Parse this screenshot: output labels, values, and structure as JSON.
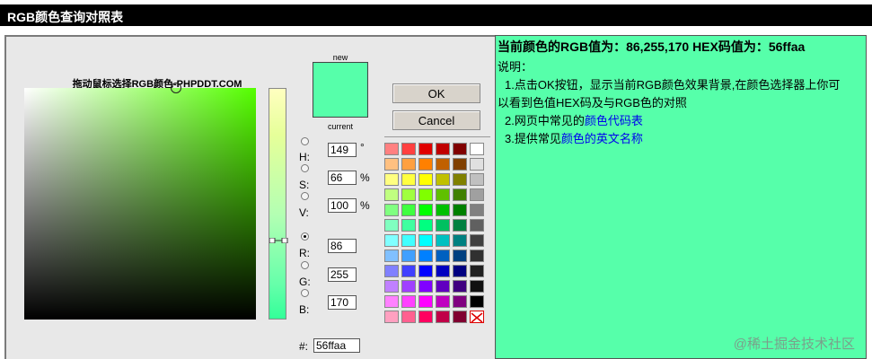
{
  "title": "RGB颜色查询对照表",
  "picker": {
    "drag_label": "拖动鼠标选择RGB颜色-PHPDDT.COM",
    "new_label": "new",
    "current_label": "current",
    "ok_label": "OK",
    "cancel_label": "Cancel",
    "selected_color": "#56ffaa",
    "fields": {
      "h": {
        "label": "H:",
        "value": "149",
        "unit": "°"
      },
      "s": {
        "label": "S:",
        "value": "66",
        "unit": "%"
      },
      "v": {
        "label": "V:",
        "value": "100",
        "unit": "%"
      },
      "r": {
        "label": "R:",
        "value": "86"
      },
      "g": {
        "label": "G:",
        "value": "255"
      },
      "b": {
        "label": "B:",
        "value": "170"
      }
    },
    "hex_label": "#:",
    "hex_value": "56ffaa",
    "palette": [
      [
        "#ff8080",
        "#ff4040",
        "#e00000",
        "#c00000",
        "#800000",
        "#ffffff"
      ],
      [
        "#ffc080",
        "#ffa040",
        "#ff8000",
        "#c06000",
        "#804000",
        "#e0e0e0"
      ],
      [
        "#ffff80",
        "#ffff40",
        "#ffff00",
        "#c0c000",
        "#808000",
        "#c0c0c0"
      ],
      [
        "#c0ff80",
        "#a0ff40",
        "#80ff00",
        "#60c000",
        "#408000",
        "#a0a0a0"
      ],
      [
        "#80ff80",
        "#40ff40",
        "#00ff00",
        "#00c000",
        "#008000",
        "#808080"
      ],
      [
        "#80ffc0",
        "#40ffa0",
        "#00ff80",
        "#00c060",
        "#008040",
        "#606060"
      ],
      [
        "#80ffff",
        "#40ffff",
        "#00ffff",
        "#00c0c0",
        "#008080",
        "#404040"
      ],
      [
        "#80c0ff",
        "#40a0ff",
        "#0080ff",
        "#0060c0",
        "#004080",
        "#303030"
      ],
      [
        "#8080ff",
        "#4040ff",
        "#0000ff",
        "#0000c0",
        "#000080",
        "#202020"
      ],
      [
        "#c080ff",
        "#a040ff",
        "#8000ff",
        "#6000c0",
        "#400080",
        "#101010"
      ],
      [
        "#ff80ff",
        "#ff40ff",
        "#ff00ff",
        "#c000c0",
        "#800080",
        "#000000"
      ],
      [
        "#ffa0c0",
        "#ff6090",
        "#ff0060",
        "#c00048",
        "#800030",
        "none"
      ]
    ]
  },
  "info": {
    "headline": "当前颜色的RGB值为：86,255,170 HEX码值为：56ffaa",
    "intro": "说明：",
    "line1a": "1.点击OK按钮，显示当前RGB颜色效果背景,在颜色选择器上你可",
    "line1b": "以看到色值HEX码及与RGB色的对照",
    "line2_prefix": "2.网页中常见的",
    "line2_link": "颜色代码表",
    "line3_prefix": "3.提供常见",
    "line3_link": "颜色的英文名称",
    "watermark": "@稀土掘金技术社区"
  }
}
